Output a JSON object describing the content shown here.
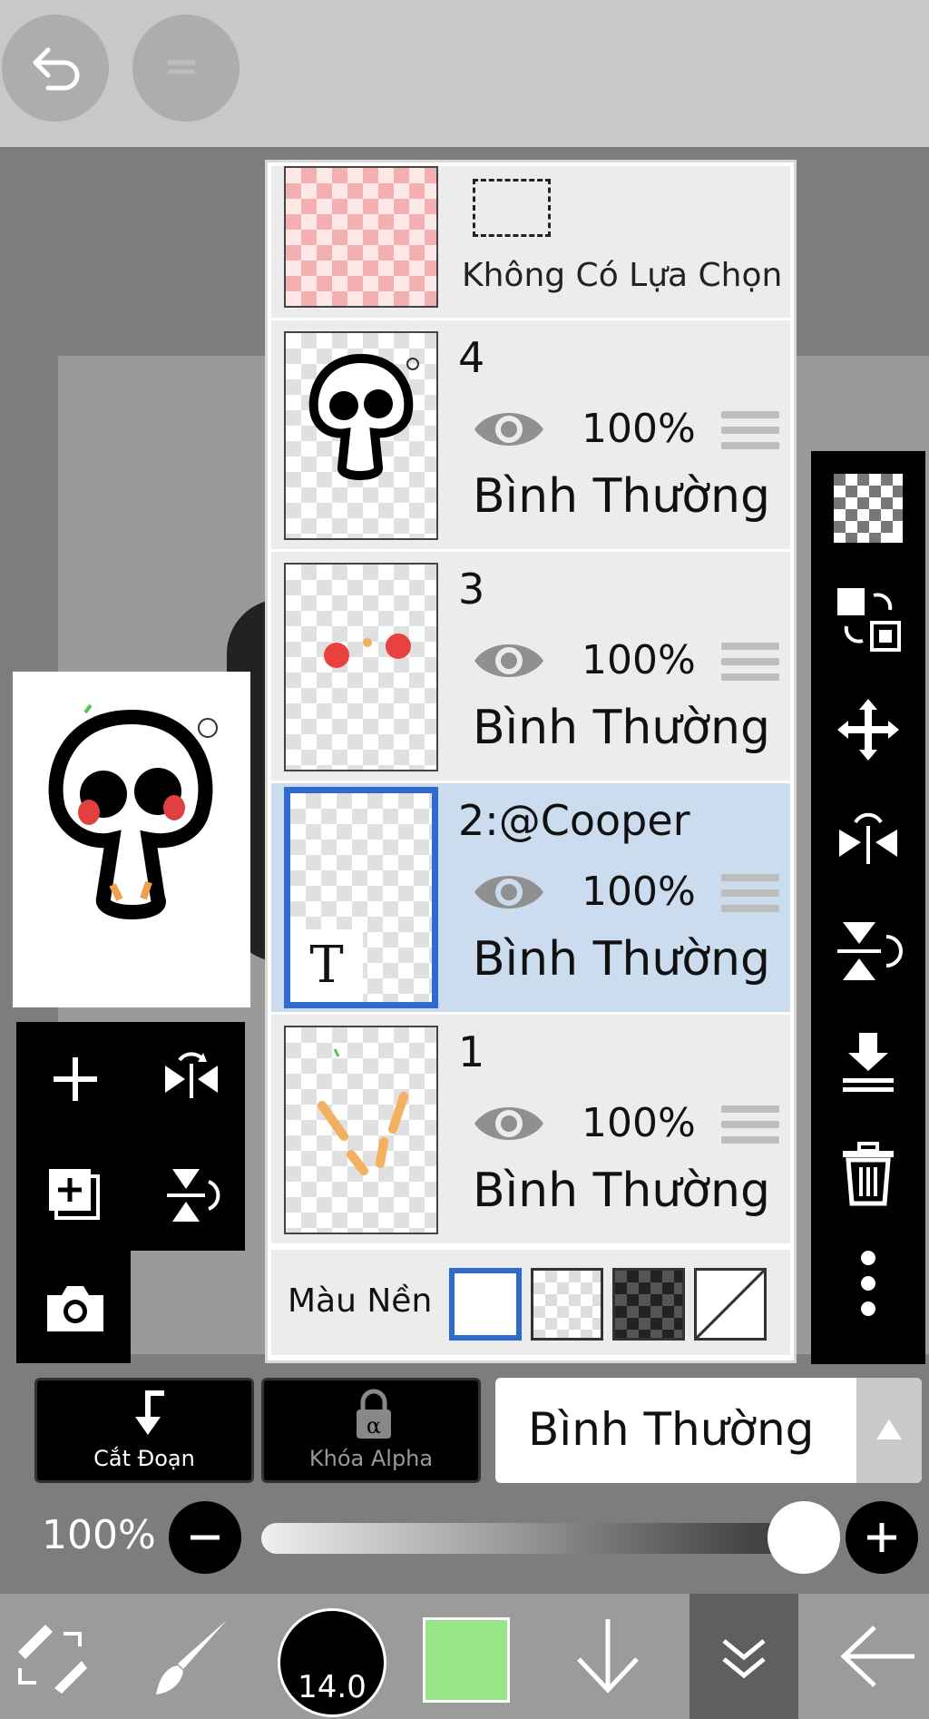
{
  "toolbar": {
    "undo_icon": "undo-icon",
    "redo_icon": "redo-icon"
  },
  "layers": {
    "selection_layer": {
      "label": "Không Có Lựa Chọn"
    },
    "items": [
      {
        "name": "4",
        "opacity": "100%",
        "blend": "Bình Thường",
        "selected": false
      },
      {
        "name": "3",
        "opacity": "100%",
        "blend": "Bình Thường",
        "selected": false
      },
      {
        "name": "2:@Cooper",
        "opacity": "100%",
        "blend": "Bình Thường",
        "selected": true,
        "badge": "T"
      },
      {
        "name": "1",
        "opacity": "100%",
        "blend": "Bình Thường",
        "selected": false
      }
    ],
    "background": {
      "label": "Màu Nền",
      "options": [
        "white",
        "transparent",
        "dark-checker",
        "none"
      ],
      "selected": "white"
    }
  },
  "actions": {
    "clip_label": "Cắt Đoạn",
    "alpha_lock_label": "Khóa Alpha",
    "blend_mode": "Bình Thường"
  },
  "opacity": {
    "label": "100%",
    "value": 1.0
  },
  "bottom": {
    "brush_size": "14.0",
    "color": "#98e68a"
  }
}
